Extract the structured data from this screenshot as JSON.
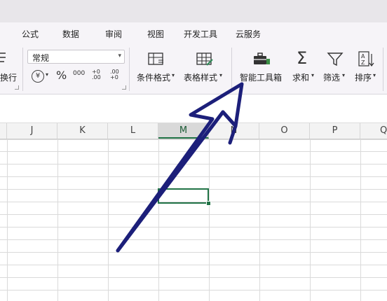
{
  "menu": {
    "items": [
      "公式",
      "数据",
      "审阅",
      "视图",
      "开发工具",
      "云服务"
    ]
  },
  "ribbon": {
    "wrap_text_label": "换行",
    "number_format": {
      "selected": "常规"
    },
    "currency_symbol": "¥",
    "percent_symbol": "%",
    "thousands_symbol": "000",
    "increase_decimal": "+0 .00",
    "decrease_decimal": ".00 +0",
    "conditional_format_label": "条件格式",
    "table_style_label": "表格样式",
    "smart_toolbox_label": "智能工具箱",
    "sum_label": "求和",
    "filter_label": "筛选",
    "sort_label": "排序"
  },
  "columns": [
    "J",
    "K",
    "L",
    "M",
    "N",
    "O",
    "P",
    "Q"
  ],
  "selected_column": "M",
  "colors": {
    "selection": "#217346",
    "arrow": "#1c1f7a"
  }
}
